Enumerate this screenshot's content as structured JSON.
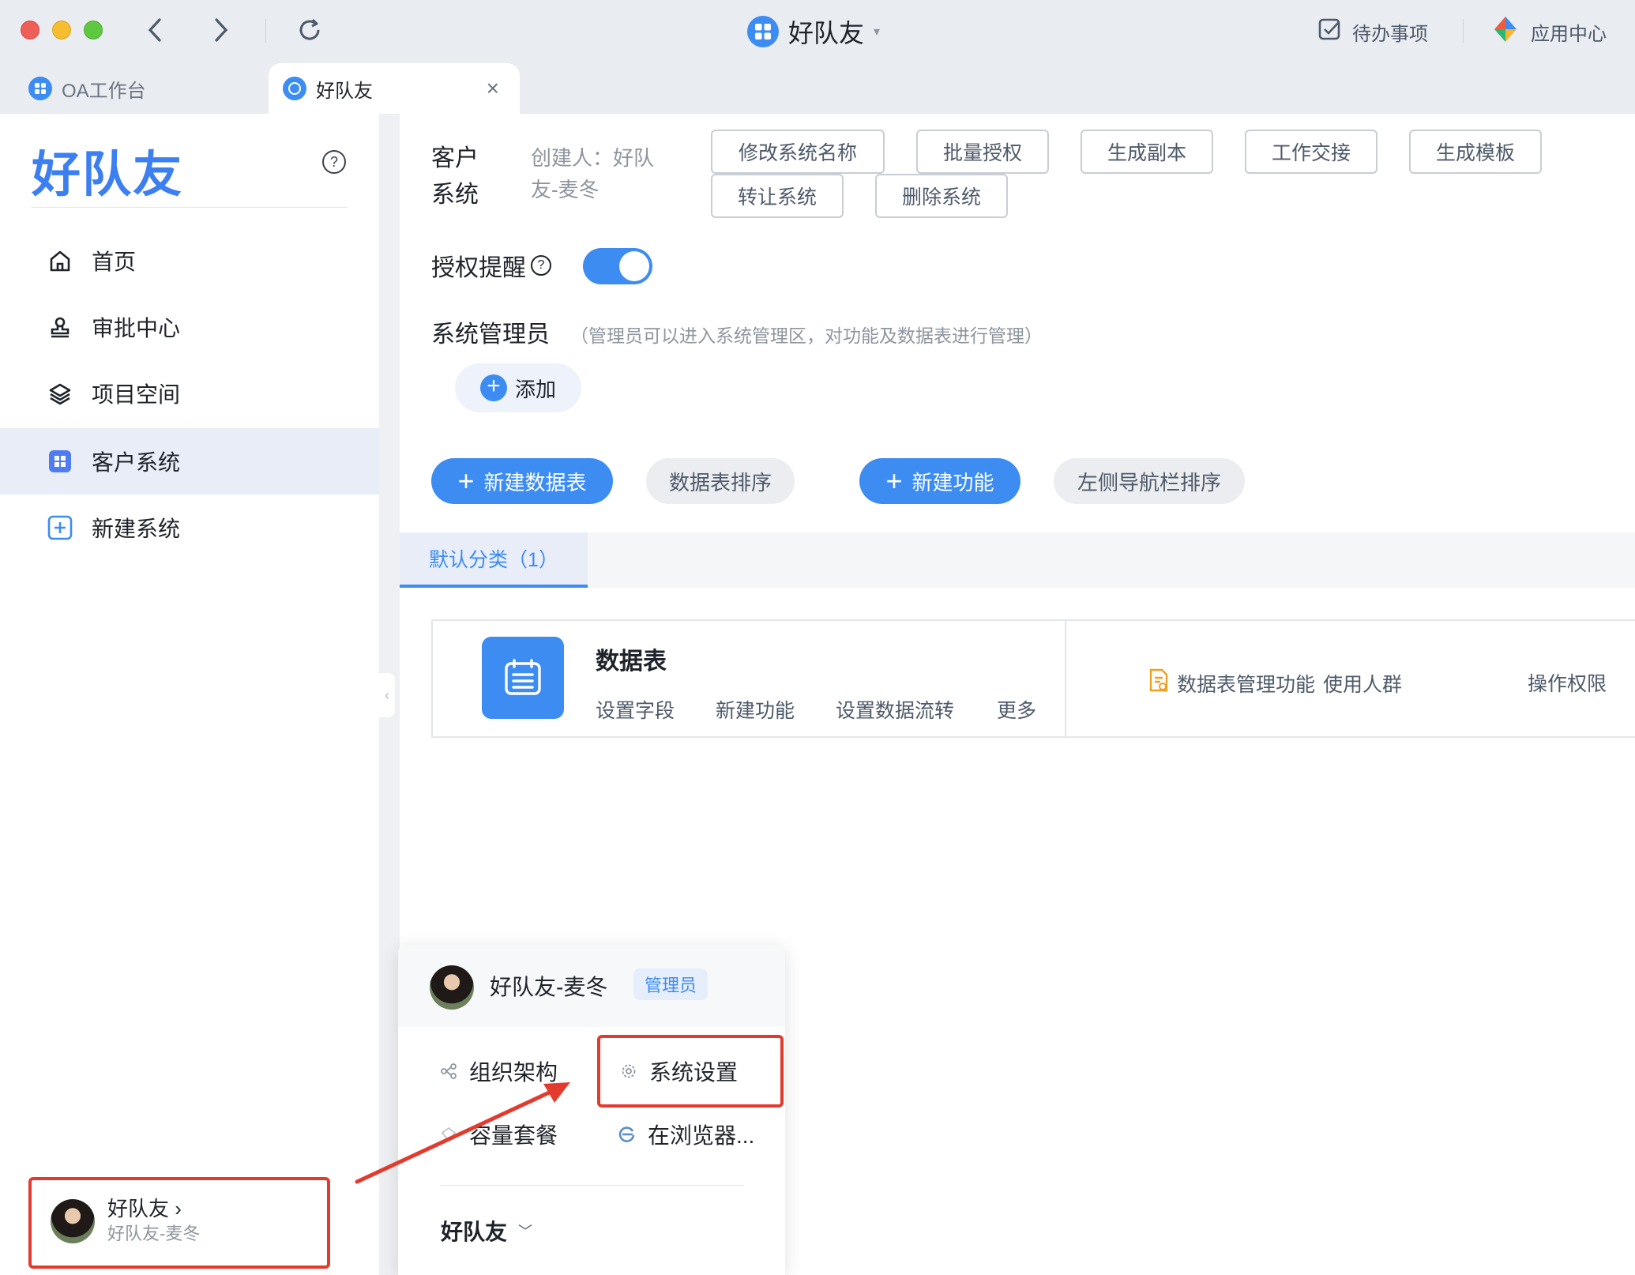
{
  "titlebar": {
    "app_name": "好队友",
    "todo_label": "待办事项",
    "apps_label": "应用中心"
  },
  "tabs": [
    {
      "label": "OA工作台",
      "active": false
    },
    {
      "label": "好队友",
      "active": true
    }
  ],
  "sidebar": {
    "brand": "好队友",
    "help": "?",
    "items": [
      {
        "label": "首页",
        "icon": "home-icon"
      },
      {
        "label": "审批中心",
        "icon": "stamp-icon"
      },
      {
        "label": "项目空间",
        "icon": "layers-icon"
      },
      {
        "label": "客户系统",
        "icon": "app-grid-icon",
        "selected": true
      },
      {
        "label": "新建系统",
        "icon": "plus-square-icon"
      }
    ],
    "user": {
      "team": "好队友",
      "name": "好队友-麦冬"
    }
  },
  "main": {
    "system_name": "客户系统",
    "creator": "创建人：好队友-麦冬",
    "actions": [
      "修改系统名称",
      "批量授权",
      "生成副本",
      "工作交接",
      "生成模板",
      "转让系统",
      "删除系统"
    ],
    "auth_reminder": {
      "label": "授权提醒",
      "enabled": true
    },
    "admin": {
      "title": "系统管理员",
      "hint": "（管理员可以进入系统管理区，对功能及数据表进行管理）",
      "add_label": "添加"
    },
    "toolbar": {
      "new_table": "新建数据表",
      "table_sort": "数据表排序",
      "new_feature": "新建功能",
      "nav_sort": "左侧导航栏排序"
    },
    "category_tab": "默认分类（1）",
    "card": {
      "title": "数据表",
      "links": [
        "设置字段",
        "新建功能",
        "设置数据流转",
        "更多"
      ],
      "feature_label": "数据表管理功能",
      "users_label": "使用人群",
      "perm_label": "操作权限"
    }
  },
  "popup": {
    "name": "好队友-麦冬",
    "badge": "管理员",
    "items": [
      "组织架构",
      "系统设置",
      "容量套餐",
      "在浏览器..."
    ],
    "team": "好队友"
  },
  "colors": {
    "accent": "#3c8cf2",
    "highlight_box": "#e23b2e"
  }
}
